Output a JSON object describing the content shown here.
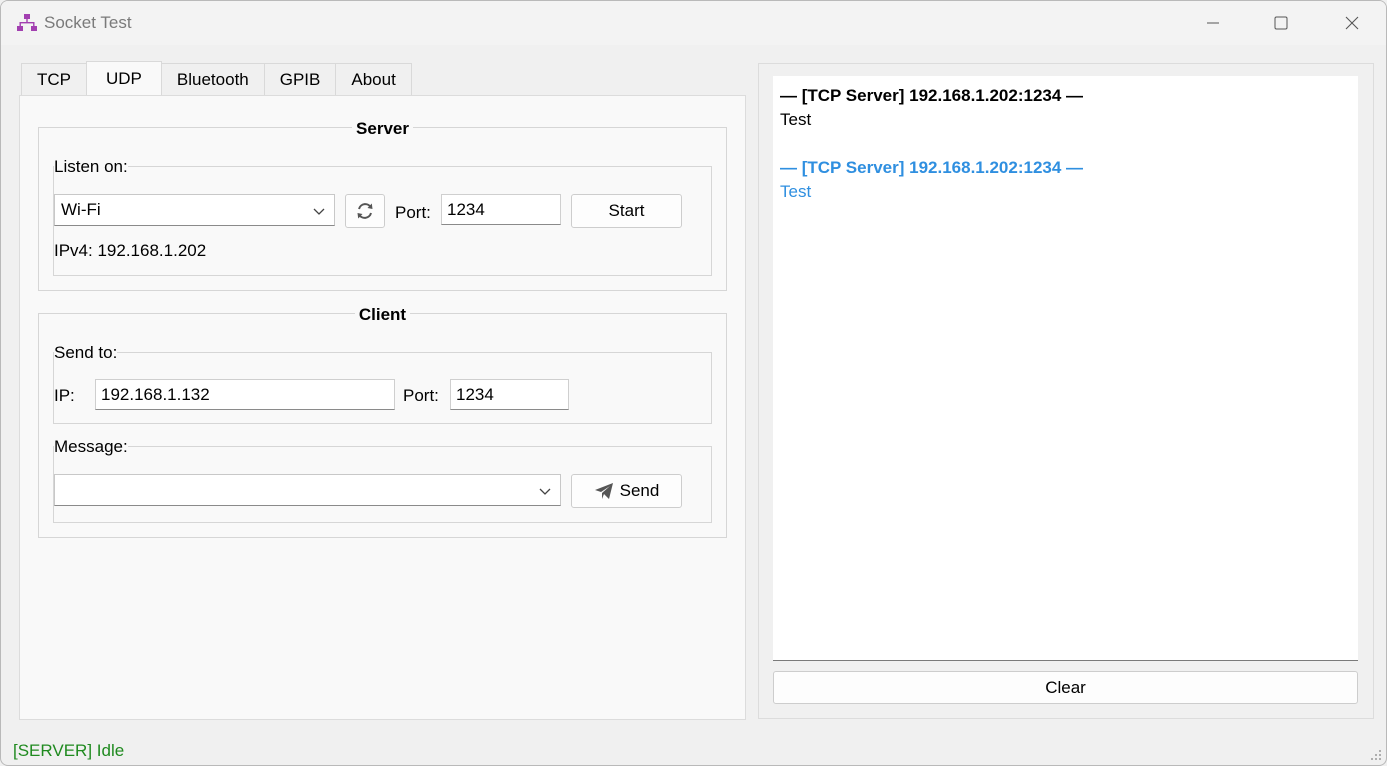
{
  "window": {
    "title": "Socket Test",
    "icon": "network-icon"
  },
  "tabs": [
    {
      "label": "TCP",
      "active": false
    },
    {
      "label": "UDP",
      "active": true
    },
    {
      "label": "Bluetooth",
      "active": false
    },
    {
      "label": "GPIB",
      "active": false
    },
    {
      "label": "About",
      "active": false
    }
  ],
  "server": {
    "title": "Server",
    "listen_label": "Listen on:",
    "interface_value": "Wi-Fi",
    "port_label": "Port:",
    "port_value": "1234",
    "start_label": "Start",
    "ipv4_text": "IPv4: 192.168.1.202"
  },
  "client": {
    "title": "Client",
    "send_to_label": "Send to:",
    "ip_label": "IP:",
    "ip_value": "192.168.1.132",
    "port_label": "Port:",
    "port_value": "1234",
    "message_label": "Message:",
    "message_value": "",
    "send_label": "Send"
  },
  "log": {
    "entries": [
      {
        "header": "— [TCP Server] 192.168.1.202:1234 —",
        "body": "Test",
        "color": "#000000"
      },
      {
        "header": "— [TCP Server] 192.168.1.202:1234 —",
        "body": "Test",
        "color": "#2f8fe0"
      }
    ],
    "clear_label": "Clear"
  },
  "status": {
    "text": "[SERVER] Idle",
    "color": "#1f8a1f"
  }
}
